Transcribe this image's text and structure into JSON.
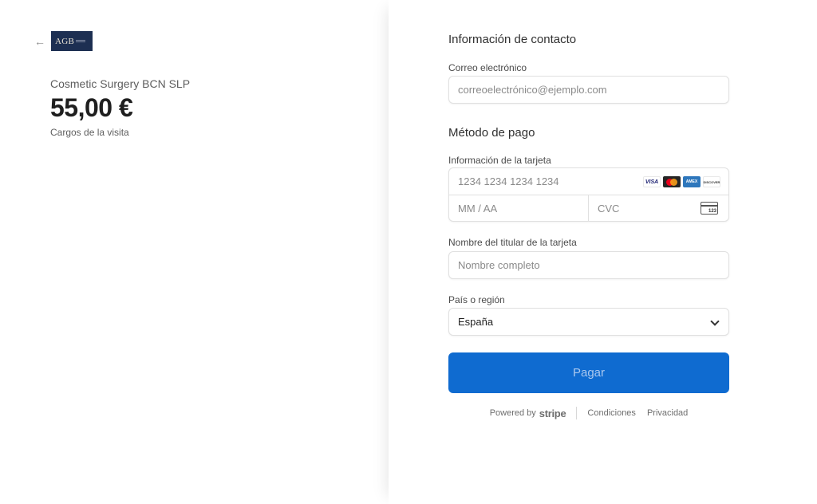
{
  "summary": {
    "logo_text": "AGB",
    "merchant_name": "Cosmetic Surgery BCN SLP",
    "amount": "55,00 €",
    "description": "Cargos de la visita"
  },
  "contact": {
    "section_title": "Información de contacto",
    "email_label": "Correo electrónico",
    "email_placeholder": "correoelectrónico@ejemplo.com"
  },
  "payment": {
    "section_title": "Método de pago",
    "card_label": "Información de la tarjeta",
    "card_number_placeholder": "1234 1234 1234 1234",
    "expiry_placeholder": "MM / AA",
    "cvc_placeholder": "CVC",
    "cvc_icon_text": "123",
    "brands": {
      "visa": "VISA",
      "amex": "AMEX",
      "discover": "DISCOVER"
    },
    "cardholder_label": "Nombre del titular de la tarjeta",
    "cardholder_placeholder": "Nombre completo",
    "country_label": "País o región",
    "country_value": "España",
    "pay_button": "Pagar"
  },
  "footer": {
    "powered_by": "Powered by",
    "stripe": "stripe",
    "terms": "Condiciones",
    "privacy": "Privacidad"
  },
  "colors": {
    "accent": "#0f6bd0",
    "logo_bg": "#1d2f52"
  }
}
